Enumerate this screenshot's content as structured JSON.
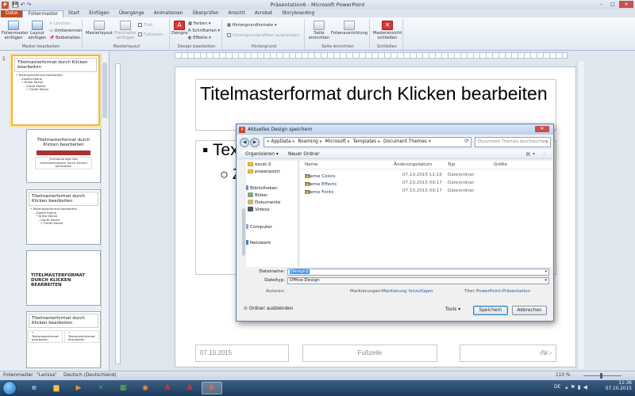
{
  "window": {
    "title": "Präsentation6 - Microsoft PowerPoint",
    "app_icon": "P",
    "controls": [
      "–",
      "□",
      "✕"
    ]
  },
  "tabs": [
    "Datei",
    "Folienmaster",
    "Start",
    "Einfügen",
    "Übergänge",
    "Animationen",
    "Überprüfen",
    "Ansicht",
    "Acrobat",
    "Storyboarding"
  ],
  "ribbon": {
    "groups": {
      "master_bearbeiten": "Master bearbeiten",
      "masterlayout": "Masterlayout",
      "design_bearbeiten": "Design bearbeiten",
      "hintergrund": "Hintergrund",
      "seite_einrichten": "Seite einrichten",
      "schliessen": "Schließen"
    },
    "buttons": {
      "folienmaster_einfuegen": "Folienmaster einfügen",
      "layout_einfuegen": "Layout einfügen",
      "loeschen": "Löschen",
      "umbenennen": "Umbenennen",
      "beibehalten": "Beibehalten",
      "masterlayout": "Masterlayout",
      "platzhalter_einfuegen": "Platzhalter einfügen",
      "titel": "Titel",
      "fusszeilen": "Fußzeilen",
      "designs": "Designs",
      "farben": "Farben",
      "schriftarten": "Schriftarten",
      "effekte": "Effekte",
      "hintergrundformate": "Hintergrundformate",
      "hintergrundgrafiken_ausblenden": "Hintergrundgrafiken ausblenden",
      "seite_einrichten": "Seite einrichten",
      "folienausrichtung": "Folienausrichtung",
      "masteransicht_schliessen": "Masteransicht schließen"
    }
  },
  "thumbnails": [
    {
      "num": "1",
      "title": "Titelmasterformat durch Klicken bearbeiten",
      "lines": [
        "• Textmasterformat bearbeiten",
        "– Zweite Ebene",
        "• Dritte Ebene",
        "– Vierte Ebene",
        "» Fünfte Ebene"
      ]
    },
    {
      "title": "Titelmasterformat durch Klicken bearbeiten",
      "sub": "Formatvorlage des Untertitelmasters durch Klicken bearbeiten"
    },
    {
      "title": "Titelmasterformat durch Klicken bearbeiten",
      "lines": [
        "• Textmasterformat bearbeiten",
        "– Zweite Ebene",
        "• Dritte Ebene",
        "– Vierte Ebene",
        "» Fünfte Ebene"
      ]
    },
    {
      "title": "TITELMASTERFORMAT DURCH KLICKEN BEARBEITEN"
    },
    {
      "title": "Titelmasterformat durch Klicken bearbeiten",
      "lines": [
        "• Textmasterformat bearbeiten",
        "• Textmasterformat bearbeiten"
      ]
    }
  ],
  "slide": {
    "title": "Titelmasterformat durch Klicken bearbeiten",
    "bullet1": "▪ Tex",
    "bullet2": "○ Z",
    "footer_date": "07.10.2015",
    "footer_center": "Fußzeile",
    "footer_num": "‹Nr.›"
  },
  "dialog": {
    "title": "Aktuelles Design speichern",
    "address": [
      "AppData",
      "Roaming",
      "Microsoft",
      "Templates",
      "Document Themes"
    ],
    "search_placeholder": "Document Themes durchsuchen",
    "toolbar": {
      "organize": "Organisieren ▾",
      "new_folder": "Neuer Ordner"
    },
    "tree": [
      {
        "label": "excel-3",
        "icon": "folder"
      },
      {
        "label": "powerpoint",
        "icon": "folder"
      },
      {
        "label": "Bibliotheken",
        "icon": "library"
      },
      {
        "label": "Bilder",
        "icon": "library"
      },
      {
        "label": "Dokumente",
        "icon": "library"
      },
      {
        "label": "Videos",
        "icon": "library"
      },
      {
        "label": "Computer",
        "icon": "computer"
      },
      {
        "label": "Netzwerk",
        "icon": "network"
      }
    ],
    "columns": [
      "Name",
      "Änderungsdatum",
      "Typ",
      "Größe"
    ],
    "files": [
      {
        "name": "Theme Colors",
        "date": "07.10.2015 11:16",
        "type": "Dateiordner"
      },
      {
        "name": "Theme Effects",
        "date": "07.10.2015 09:17",
        "type": "Dateiordner"
      },
      {
        "name": "Theme Fonts",
        "date": "07.10.2015 09:17",
        "type": "Dateiordner"
      }
    ],
    "filename_label": "Dateiname:",
    "filename_value": "Design2",
    "filetype_label": "Dateityp:",
    "filetype_value": "Office-Design",
    "authors_label": "Autoren:",
    "authors_value": "",
    "tags_label": "Markierungen:",
    "tags_value": "Markierung hinzufügen",
    "title_label": "Titel:",
    "title_value": "PowerPoint-Präsentation",
    "hide_folders": "Ordner ausblenden",
    "tools": "Tools",
    "save": "Speichern",
    "cancel": "Abbrechen"
  },
  "statusbar": {
    "view": "Folienmaster",
    "theme": "\"Larissa\"",
    "language": "Deutsch (Deutschland)",
    "zoom": "110 %"
  },
  "taskbar": {
    "lang": "DE",
    "time": "11:36",
    "date": "07.10.2015"
  },
  "colors": {
    "file_tab": "#c44b25",
    "accent_blue": "#3399ff",
    "close_red": "#c75050",
    "thumb_selected": "#f4b63a"
  }
}
